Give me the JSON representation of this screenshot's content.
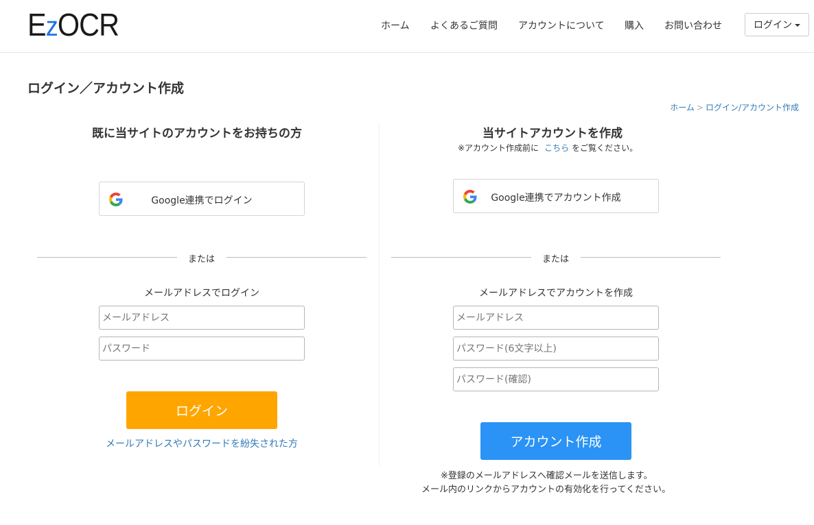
{
  "header": {
    "logo_text_pre": "E",
    "logo_text_z": "z",
    "logo_text_post": "OCR",
    "nav": [
      "ホーム",
      "よくあるご質問",
      "アカウントについて",
      "購入",
      "お問い合わせ"
    ],
    "login_dropdown": "ログイン"
  },
  "page": {
    "title": "ログイン／アカウント作成",
    "breadcrumb": {
      "home": "ホーム",
      "separator": ">",
      "current": "ログイン/アカウント作成"
    }
  },
  "login": {
    "title": "既に当サイトのアカウントをお持ちの方",
    "google_label": "Google連携でログイン",
    "or": "または",
    "email_section": "メールアドレスでログイン",
    "email_placeholder": "メールアドレス",
    "password_placeholder": "パスワード",
    "submit": "ログイン",
    "forgot": "メールアドレスやパスワードを紛失された方"
  },
  "register": {
    "title": "当サイトアカウントを作成",
    "note_pre": "※アカウント作成前に",
    "note_link": "こちら",
    "note_post": "をご覧ください。",
    "google_label": "Google連携でアカウント作成",
    "or": "または",
    "email_section": "メールアドレスでアカウントを作成",
    "email_placeholder": "メールアドレス",
    "password_placeholder": "パスワード(6文字以上)",
    "confirm_placeholder": "パスワード(確認)",
    "submit": "アカウント作成",
    "notice_line1": "※登録のメールアドレスへ確認メールを送信します。",
    "notice_line2": "メール内のリンクからアカウントの有効化を行ってください。"
  },
  "colors": {
    "login_button": "#ffa500",
    "create_button": "#2a93f5",
    "link": "#337ab7",
    "logo_accent": "#1a73e8"
  },
  "icons": {
    "google": "google-logo-icon",
    "caret": "caret-down-icon"
  }
}
